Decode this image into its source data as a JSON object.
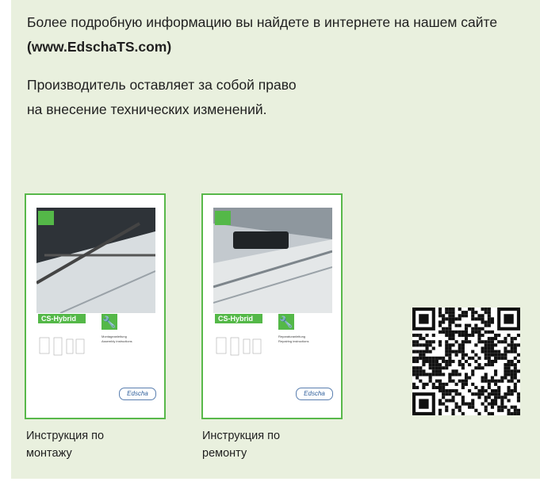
{
  "info_text_before": "Более подробную информацию вы найдете в интернете на нашем сайте ",
  "info_link": "(www.EdschaTS.com)",
  "disclaimer": "Производитель оставляет за собой право на внесение технических изменений.",
  "booklets": [
    {
      "caption": "Инструкция по монтажу",
      "product": "CS-Hybrid",
      "manual_de": "Montageanleitung",
      "manual_en": "Assembly instructions",
      "brand": "Edscha",
      "icon": "wrench-icon"
    },
    {
      "caption": "Инструкция по ремонту",
      "product": "CS-Hybrid",
      "manual_de": "Reparaturanleitung",
      "manual_en": "Repairing instructions",
      "brand": "Edscha",
      "icon": "wrench-plus-icon"
    }
  ],
  "qr_code": "qr-code-icon",
  "colors": {
    "panel": "#e9f0de",
    "accent": "#54b848"
  }
}
